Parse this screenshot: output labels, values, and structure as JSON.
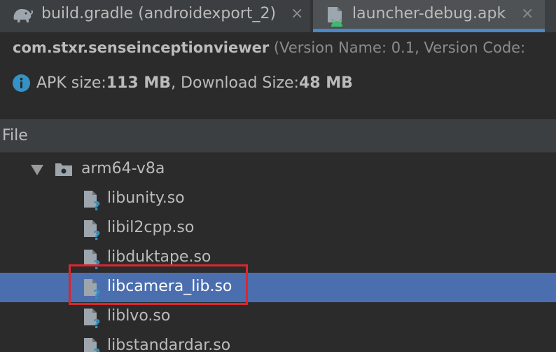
{
  "tabs": [
    {
      "label": "build.gradle (androidexport_2)",
      "close": "×",
      "icon": "gradle-elephant-icon",
      "active": false
    },
    {
      "label": "launcher-debug.apk",
      "close": "×",
      "icon": "apk-android-file-icon",
      "active": true
    }
  ],
  "summary": {
    "package": "com.stxr.senseinceptionviewer",
    "meta": " (Version Name: 0.1, Version Code:",
    "apk_size_label": "APK size: ",
    "apk_size_value": "113 MB",
    "download_label": ", Download Size: ",
    "download_value": "48 MB",
    "info_icon": "info-circle-icon"
  },
  "column_header": "File",
  "tree": {
    "folder": {
      "label": "arm64-v8a",
      "icon": "folder-icon",
      "expanded": true
    },
    "files": [
      {
        "label": "libunity.so",
        "icon": "unknown-file-icon",
        "selected": false
      },
      {
        "label": "libil2cpp.so",
        "icon": "unknown-file-icon",
        "selected": false
      },
      {
        "label": "libduktape.so",
        "icon": "unknown-file-icon",
        "selected": false
      },
      {
        "label": "libcamera_lib.so",
        "icon": "unknown-file-icon",
        "selected": true
      },
      {
        "label": "liblvo.so",
        "icon": "unknown-file-icon",
        "selected": false
      },
      {
        "label": "libstandardar.so",
        "icon": "unknown-file-icon",
        "selected": false
      }
    ]
  },
  "colors": {
    "background": "#2b2b2b",
    "panel": "#3c3f41",
    "selection": "#4b6eaf",
    "accent_underline": "#4a88c7",
    "annotation_box": "#d9272e"
  }
}
